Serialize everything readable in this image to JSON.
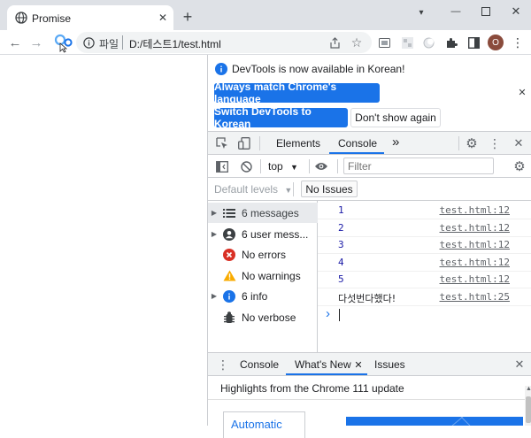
{
  "browser": {
    "tab_title": "Promise",
    "new_tab": "+",
    "minimize": "—",
    "maximize": "☐",
    "close": "✕",
    "url_scheme": "파일",
    "url": "D:/테스트1/test.html",
    "profile_initial": "O",
    "profile_color": "#8a4b3c"
  },
  "devtools": {
    "banner": "DevTools is now available in Korean!",
    "btn_match": "Always match Chrome's language",
    "btn_switch": "Switch DevTools to Korean",
    "btn_dismiss": "Don't show again",
    "tabs": {
      "elements": "Elements",
      "console": "Console",
      "more": "»"
    },
    "context": "top",
    "filter_placeholder": "Filter",
    "levels": "Default levels",
    "issues": "No Issues",
    "sidebar": [
      {
        "label": "6 messages",
        "icon": "list-icon",
        "expandable": true
      },
      {
        "label": "6 user mess...",
        "icon": "user-icon",
        "expandable": true
      },
      {
        "label": "No errors",
        "icon": "error-icon",
        "expandable": false
      },
      {
        "label": "No warnings",
        "icon": "warning-icon",
        "expandable": false
      },
      {
        "label": "6 info",
        "icon": "info-icon",
        "expandable": true
      },
      {
        "label": "No verbose",
        "icon": "bug-icon",
        "expandable": false
      }
    ],
    "logs": [
      {
        "value": "1",
        "source": "test.html:12"
      },
      {
        "value": "2",
        "source": "test.html:12"
      },
      {
        "value": "3",
        "source": "test.html:12"
      },
      {
        "value": "4",
        "source": "test.html:12"
      },
      {
        "value": "5",
        "source": "test.html:12"
      },
      {
        "value": "다섯번다했다!",
        "source": "test.html:25"
      }
    ],
    "prompt": "›",
    "drawer_tabs": {
      "console": "Console",
      "whats_new": "What's New",
      "issues": "Issues"
    },
    "highlights": "Highlights from the Chrome 111 update",
    "automatic": "Automatic"
  },
  "colors": {
    "accent": "#1a73e8",
    "error": "#d93025",
    "warning": "#f9ab00",
    "info": "#1a73e8"
  }
}
